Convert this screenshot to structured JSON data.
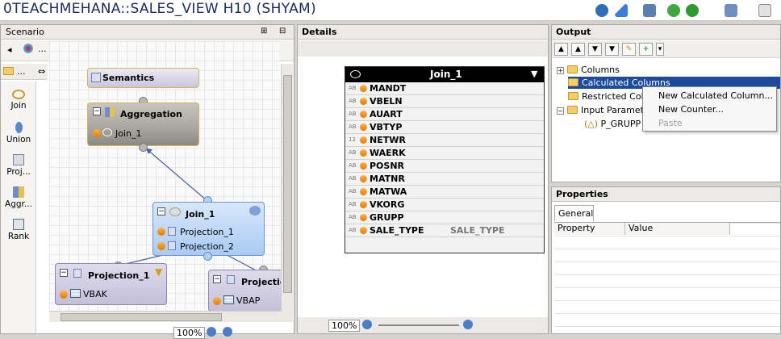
{
  "window": {
    "title": "0TEACHMEHANA::SALES_VIEW H10 (SHYAM)"
  },
  "scenario": {
    "title": "Scenario",
    "palette_more": "...",
    "palette": [
      {
        "label": "Join",
        "icon": "join-icon"
      },
      {
        "label": "Union",
        "icon": "union-icon"
      },
      {
        "label": "Proj...",
        "icon": "projection-icon"
      },
      {
        "label": "Aggr...",
        "icon": "aggregation-icon"
      },
      {
        "label": "Rank",
        "icon": "rank-icon"
      }
    ],
    "nodes": {
      "semantics": {
        "title": "Semantics"
      },
      "aggregation": {
        "title": "Aggregation",
        "input": "Join_1"
      },
      "join": {
        "title": "Join_1",
        "inputs": [
          "Projection_1",
          "Projection_2"
        ]
      },
      "projection1": {
        "title": "Projection_1",
        "source": "VBAK"
      },
      "projection2": {
        "title": "Projection",
        "source": "VBAP"
      }
    },
    "zoom": "100%"
  },
  "details": {
    "title": "Details",
    "table_title": "Join_1",
    "fields": [
      {
        "type": "AB",
        "name": "MANDT",
        "extra": ""
      },
      {
        "type": "AB",
        "name": "VBELN",
        "extra": ""
      },
      {
        "type": "AB",
        "name": "AUART",
        "extra": ""
      },
      {
        "type": "AB",
        "name": "VBTYP",
        "extra": ""
      },
      {
        "type": "12",
        "name": "NETWR",
        "extra": ""
      },
      {
        "type": "AB",
        "name": "WAERK",
        "extra": ""
      },
      {
        "type": "AB",
        "name": "POSNR",
        "extra": ""
      },
      {
        "type": "AB",
        "name": "MATNR",
        "extra": ""
      },
      {
        "type": "AB",
        "name": "MATWA",
        "extra": ""
      },
      {
        "type": "AB",
        "name": "VKORG",
        "extra": ""
      },
      {
        "type": "AB",
        "name": "GRUPP",
        "extra": ""
      },
      {
        "type": "AB",
        "name": "SALE_TYPE",
        "extra": "SALE_TYPE"
      }
    ],
    "zoom": "100%"
  },
  "output": {
    "title": "Output",
    "tree": {
      "columns": "Columns",
      "calculated": "Calculated Columns",
      "restricted": "Restricted Colu",
      "input_params": "Input Paramete",
      "param": "P_GRUPP"
    }
  },
  "context_menu": {
    "items": [
      "New Calculated Column...",
      "New Counter...",
      "Paste"
    ]
  },
  "properties": {
    "title": "Properties",
    "tab": "General",
    "columns": [
      "Property",
      "Value"
    ]
  },
  "colors": {
    "selection": "#1c4b9c",
    "node_blue": "#b8d5f7",
    "node_purple": "#d9d5ea",
    "node_grey": "#a8a59f"
  }
}
